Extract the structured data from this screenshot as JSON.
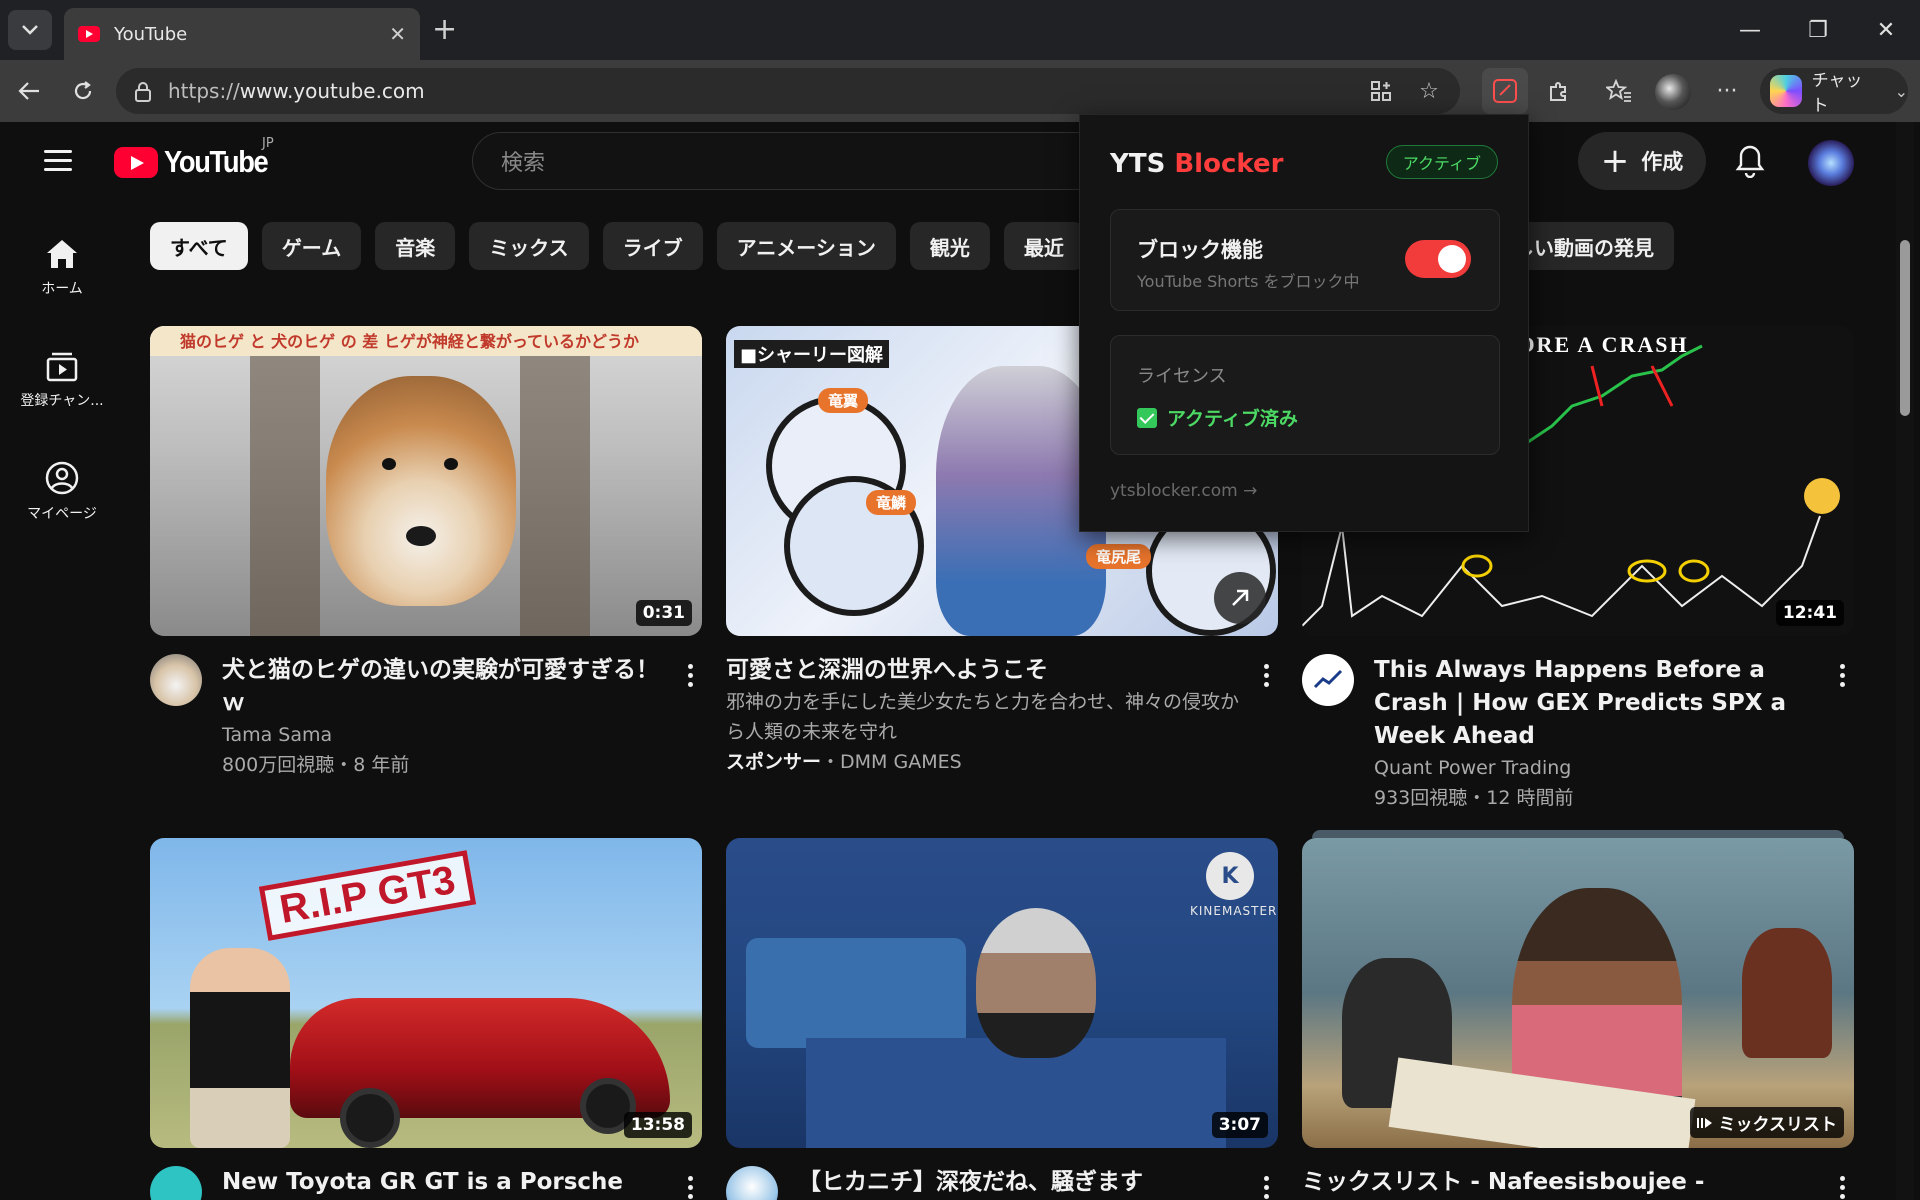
{
  "browser": {
    "tab_title": "YouTube",
    "url_scheme": "https://",
    "url_host": "www.youtube.com",
    "copilot_label": "チャット"
  },
  "youtube": {
    "region": "JP",
    "logo_text": "YouTube",
    "search_placeholder": "検索",
    "create_label": "作成",
    "sidebar": [
      {
        "label": "ホーム",
        "icon": "home-icon"
      },
      {
        "label": "登録チャン...",
        "icon": "subscriptions-icon"
      },
      {
        "label": "マイページ",
        "icon": "user-icon"
      }
    ],
    "chips": [
      "すべて",
      "ゲーム",
      "音楽",
      "ミックス",
      "ライブ",
      "アニメーション",
      "観光",
      "最近"
    ],
    "chip_tail": "しい動画の発見",
    "videos": [
      {
        "title": "犬と猫のヒゲの違いの実験が可愛すぎる！ｗ",
        "channel": "Tama Sama",
        "stats": "800万回視聴・8 年前",
        "duration": "0:31",
        "thumb_text": "猫のヒゲ と 犬のヒゲ の 差 ヒゲが神経と繋がっているかどうか"
      },
      {
        "title": "可愛さと深淵の世界へようこそ",
        "description": "邪神の力を手にした美少女たちと力を合わせ、神々の侵攻から人類の未来を守れ",
        "sponsor_label": "スポンサー",
        "channel": "・DMM GAMES",
        "thumb_text": "■シャーリー図解",
        "tags": [
          "竜翼",
          "竜鱗",
          "竜尻尾"
        ]
      },
      {
        "title": "This Always Happens Before a Crash | How GEX Predicts SPX a Week Ahead",
        "channel": "Quant Power Trading",
        "stats": "933回視聴・12 時間前",
        "duration": "12:41",
        "thumb_text": "FORE A CRASH"
      },
      {
        "title": "New Toyota GR GT is a Porsche KILLER!",
        "duration": "13:58",
        "thumb_text": "R.I.P GT3"
      },
      {
        "title": "【ヒカニチ】深夜だね、騒ぎます",
        "duration": "3:07",
        "thumb_text": "KINEMASTER"
      },
      {
        "title": "ミックスリスト - Nafeesisboujee - Stephanie",
        "badge": "ミックスリスト"
      }
    ]
  },
  "popup": {
    "title_white": "YTS",
    "title_red": "Blocker",
    "status_badge": "アクティブ",
    "block_title": "ブロック機能",
    "block_sub": "YouTube Shorts をブロック中",
    "block_enabled": true,
    "license_title": "ライセンス",
    "license_status": "アクティブ済み",
    "link": "ytsblocker.com →"
  },
  "colors": {
    "accent_red": "#ff0033",
    "toggle_red": "#f23c3c",
    "active_green": "#4cd964"
  }
}
